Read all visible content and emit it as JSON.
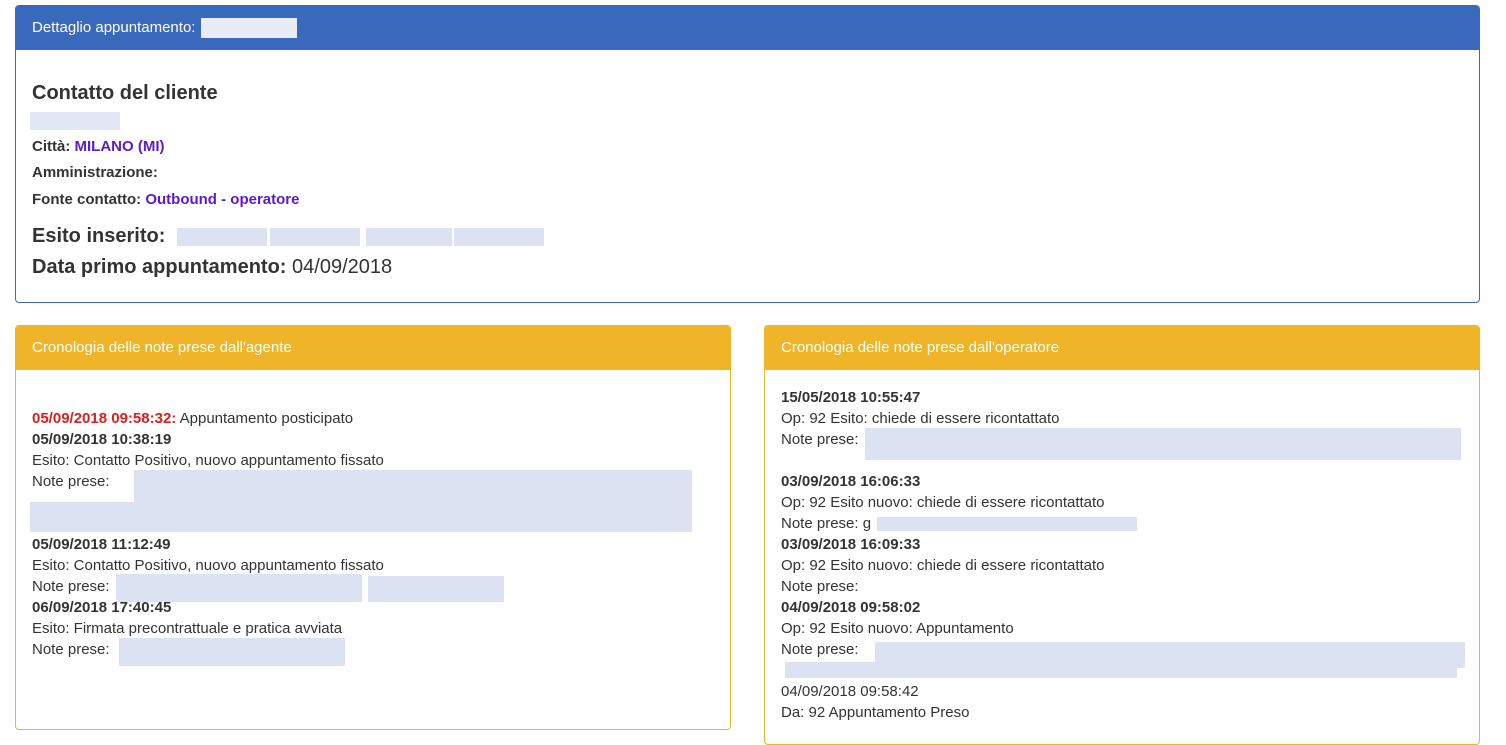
{
  "detail": {
    "title": "Dettaglio appuntamento:",
    "contact_heading": "Contatto del cliente",
    "city_label": "Città:",
    "city_value": "MILANO (MI)",
    "admin_label": "Amministrazione:",
    "source_label": "Fonte contatto:",
    "source_value": "Outbound - operatore",
    "outcome_label": "Esito inserito:",
    "first_appt_label": "Data primo appuntamento:",
    "first_appt_value": "04/09/2018"
  },
  "agent_panel": {
    "title": "Cronologia delle note prese dall'agente",
    "entries": [
      {
        "ts": "05/09/2018 09:58:32:",
        "text": "Appuntamento posticipato"
      },
      {
        "ts": "05/09/2018 10:38:19",
        "esito": "Esito: Contatto Positivo, nuovo appuntamento fissato",
        "notes": "Note  prese:"
      },
      {
        "ts": "05/09/2018 11:12:49",
        "esito": "Esito: Contatto Positivo, nuovo appuntamento fissato",
        "notes": "Note prese:"
      },
      {
        "ts": "06/09/2018 17:40:45",
        "esito": "Esito: Firmata precontrattuale e pratica avviata",
        "notes": "Note prese:"
      }
    ]
  },
  "operator_panel": {
    "title": "Cronologia delle note prese dall'operatore",
    "entries": [
      {
        "ts": "15/05/2018 10:55:47",
        "esito": "Op: 92 Esito: chiede di essere ricontattato",
        "notes": "Note prese:"
      },
      {
        "ts": "03/09/2018 16:06:33",
        "esito": "Op: 92 Esito nuovo: chiede di essere ricontattato",
        "notes": "Note prese: g"
      },
      {
        "ts": "03/09/2018 16:09:33",
        "esito": "Op: 92 Esito nuovo: chiede di essere ricontattato",
        "notes": "Note prese:"
      },
      {
        "ts": "04/09/2018 09:58:02",
        "esito": "Op: 92 Esito nuovo: Appuntamento",
        "notes": "Note   prese:"
      }
    ],
    "extra_ts": "04/09/2018 09:58:42",
    "extra_text": "Da: 92 Appuntamento Preso"
  }
}
